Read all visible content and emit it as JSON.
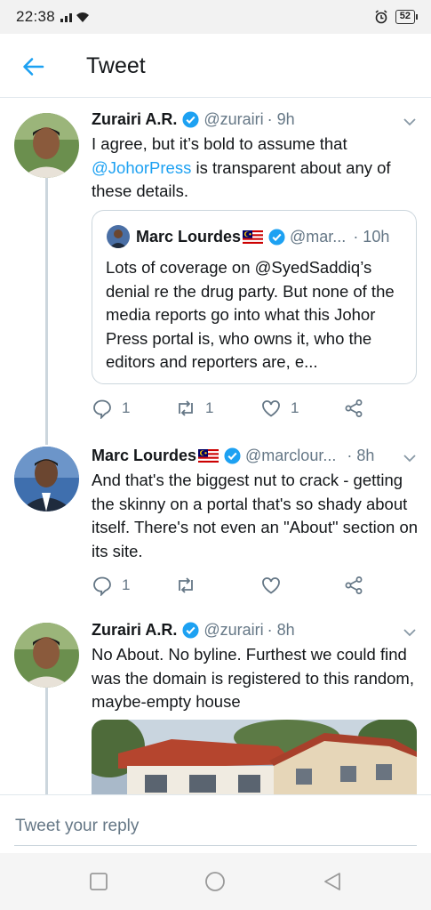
{
  "status_bar": {
    "time": "22:38",
    "battery": "52"
  },
  "header": {
    "title": "Tweet"
  },
  "tweets": [
    {
      "name": "Zurairi A.R.",
      "handle": "@zurairi",
      "time": "· 9h",
      "text_before": "I agree, but it’s bold to assume that ",
      "mention": "@JohorPress",
      "text_after": " is transparent about any of these details.",
      "quote": {
        "name": "Marc Lourdes",
        "handle": "@mar...",
        "time": "· 10h",
        "text": "Lots of coverage on @SyedSaddiq’s denial re the drug party. But none of the media reports go into what this Johor Press portal is, who owns it, who the editors and reporters are, e..."
      },
      "replies": "1",
      "retweets": "1",
      "likes": "1"
    },
    {
      "name": "Marc Lourdes",
      "handle": "@marclour...",
      "time": "· 8h",
      "text": "And that's the biggest nut to crack - getting the skinny on a portal that's so shady about itself. There's not even an \"About\" section on its site.",
      "replies": "1"
    },
    {
      "name": "Zurairi A.R.",
      "handle": "@zurairi",
      "time": "· 8h",
      "text": "No About. No byline. Furthest we could find was the domain is registered to this random, maybe-empty house"
    }
  ],
  "reply": {
    "placeholder": "Tweet your reply"
  },
  "colors": {
    "accent": "#1da1f2",
    "text": "#14171a",
    "muted": "#657786"
  },
  "icons": [
    "signal-icon",
    "wifi-icon",
    "alarm-icon",
    "back-arrow-icon",
    "verified-icon",
    "chevron-down-icon",
    "reply-icon",
    "retweet-icon",
    "like-icon",
    "share-icon",
    "malaysia-flag-icon",
    "nav-square-icon",
    "nav-circle-icon",
    "nav-triangle-icon"
  ]
}
